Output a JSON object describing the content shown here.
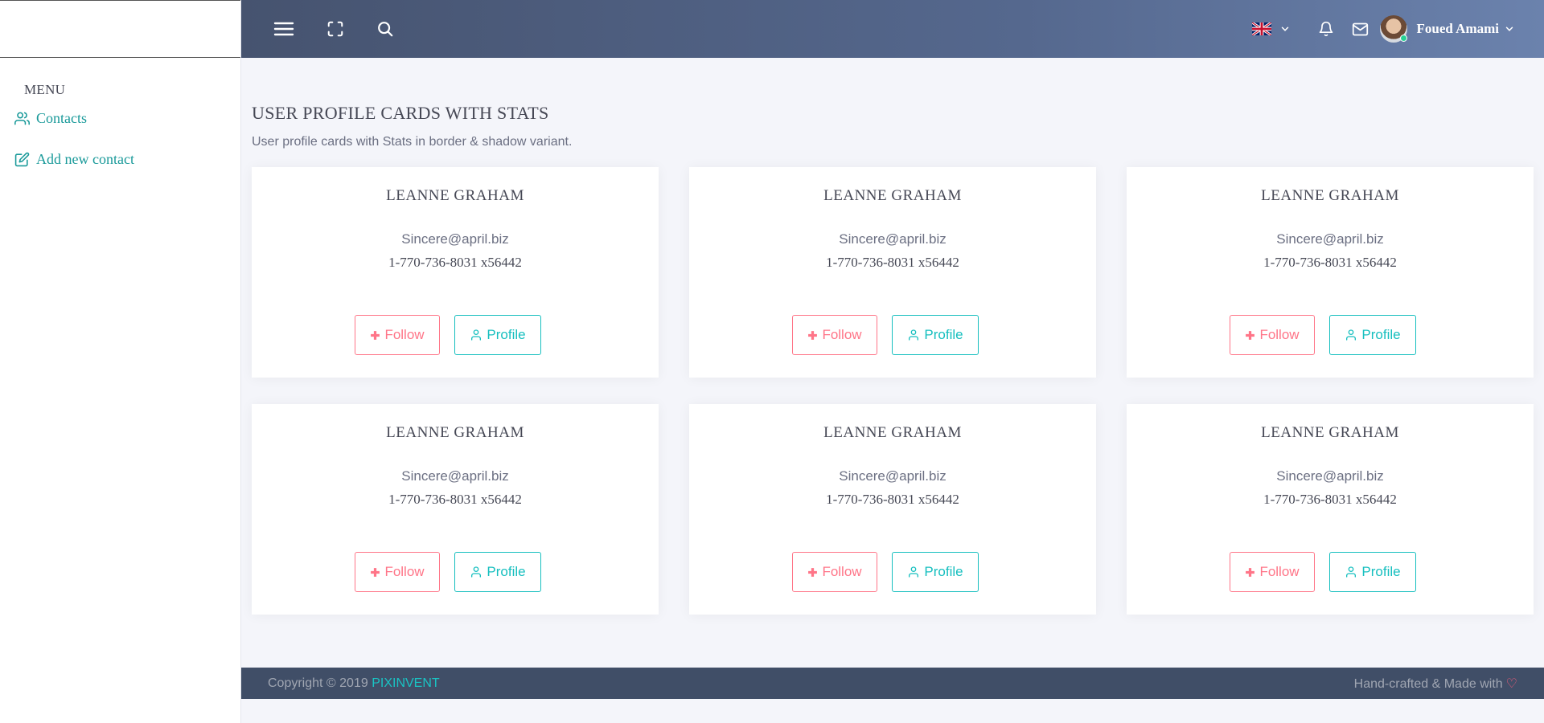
{
  "sidebar": {
    "menu_heading": "MENU",
    "items": [
      {
        "label": "Contacts",
        "icon": "users-icon"
      },
      {
        "label": "Add new contact",
        "icon": "edit-icon"
      }
    ]
  },
  "navbar": {
    "language_flag": "uk-flag-icon",
    "user_name": "Foued Amami"
  },
  "page": {
    "title": "USER PROFILE CARDS WITH STATS",
    "subtitle": "User profile cards with Stats in border & shadow variant."
  },
  "cards": [
    {
      "name": "LEANNE GRAHAM",
      "email": "Sincere@april.biz",
      "phone": "1-770-736-8031 x56442",
      "follow_label": "Follow",
      "profile_label": "Profile"
    },
    {
      "name": "LEANNE GRAHAM",
      "email": "Sincere@april.biz",
      "phone": "1-770-736-8031 x56442",
      "follow_label": "Follow",
      "profile_label": "Profile"
    },
    {
      "name": "LEANNE GRAHAM",
      "email": "Sincere@april.biz",
      "phone": "1-770-736-8031 x56442",
      "follow_label": "Follow",
      "profile_label": "Profile"
    },
    {
      "name": "LEANNE GRAHAM",
      "email": "Sincere@april.biz",
      "phone": "1-770-736-8031 x56442",
      "follow_label": "Follow",
      "profile_label": "Profile"
    },
    {
      "name": "LEANNE GRAHAM",
      "email": "Sincere@april.biz",
      "phone": "1-770-736-8031 x56442",
      "follow_label": "Follow",
      "profile_label": "Profile"
    },
    {
      "name": "LEANNE GRAHAM",
      "email": "Sincere@april.biz",
      "phone": "1-770-736-8031 x56442",
      "follow_label": "Follow",
      "profile_label": "Profile"
    }
  ],
  "footer": {
    "copyright": "Copyright © 2019",
    "brand": "PIXINVENT",
    "made_with": "Hand-crafted & Made with",
    "heart": "♡"
  },
  "colors": {
    "follow": "#ff7588",
    "profile": "#16bfbf",
    "navbar_start": "#46536f",
    "navbar_end": "#6b82ad",
    "footer_bg": "#404e67"
  }
}
